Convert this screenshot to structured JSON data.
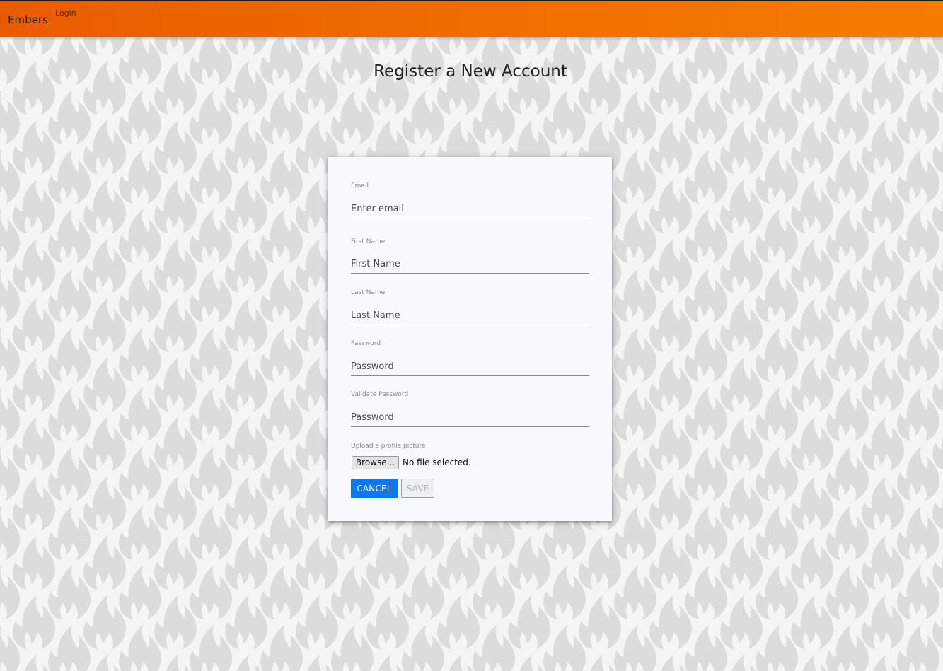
{
  "colors": {
    "navbar_start": "#e95b00",
    "navbar_end": "#f47c00",
    "page_background": "#f5f5f5",
    "flame_pattern": "#dcdcdc",
    "card_background": "#f8f9fc",
    "primary_button": "#0b78f5"
  },
  "navbar": {
    "brand": "Embers",
    "login_link": "Login"
  },
  "page": {
    "title": "Register a New Account"
  },
  "form": {
    "email": {
      "label": "Email",
      "placeholder": "Enter email",
      "value": ""
    },
    "first_name": {
      "label": "First Name",
      "placeholder": "First Name",
      "value": ""
    },
    "last_name": {
      "label": "Last Name",
      "placeholder": "Last Name",
      "value": ""
    },
    "password": {
      "label": "Password",
      "placeholder": "Password",
      "value": ""
    },
    "validate_password": {
      "label": "Validate Password",
      "placeholder": "Password",
      "value": ""
    },
    "upload": {
      "label": "Upload a profile picture",
      "browse_label": "Browse...",
      "status": "No file selected."
    },
    "cancel_label": "CANCEL",
    "save_label": "SAVE",
    "save_disabled": true
  },
  "icons": {
    "background_pattern": "flame-icon"
  }
}
